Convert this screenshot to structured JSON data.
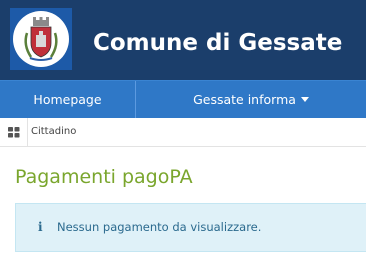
{
  "header": {
    "title": "Comune di Gessate",
    "logo": "coat-of-arms"
  },
  "nav": {
    "items": [
      {
        "label": "Homepage"
      },
      {
        "label": "Gessate informa",
        "icon": "caret-down"
      }
    ]
  },
  "breadcrumb": {
    "icon": "grid-icon",
    "label": "Cittadino"
  },
  "main": {
    "title": "Pagamenti pagoPA",
    "alert": {
      "icon": "info-icon",
      "glyph": "i",
      "text": "Nessun pagamento da visualizzare."
    }
  },
  "colors": {
    "header_bg": "#1b3e6b",
    "nav_bg": "#2f78c7",
    "title_green": "#7aa62d",
    "alert_bg": "#dff1f8",
    "alert_text": "#2b6a8e"
  }
}
